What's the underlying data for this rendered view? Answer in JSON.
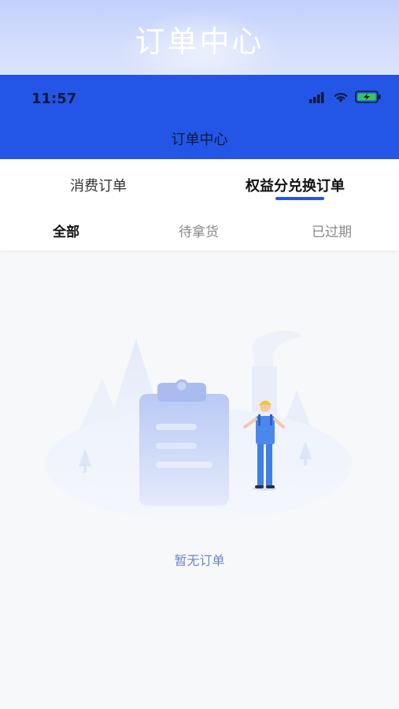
{
  "banner": {
    "title": "订单中心"
  },
  "status_bar": {
    "time": "11:57"
  },
  "nav": {
    "title": "订单中心"
  },
  "main_tabs": [
    {
      "label": "消费订单",
      "active": false
    },
    {
      "label": "权益分兑换订单",
      "active": true
    }
  ],
  "sub_tabs": [
    {
      "label": "全部",
      "active": true
    },
    {
      "label": "待拿货",
      "active": false
    },
    {
      "label": "已过期",
      "active": false
    }
  ],
  "empty_state": {
    "message": "暂无订单",
    "icon": "clipboard-worker-illustration"
  },
  "colors": {
    "primary": "#2356e6",
    "empty_text": "#6b86c9"
  }
}
